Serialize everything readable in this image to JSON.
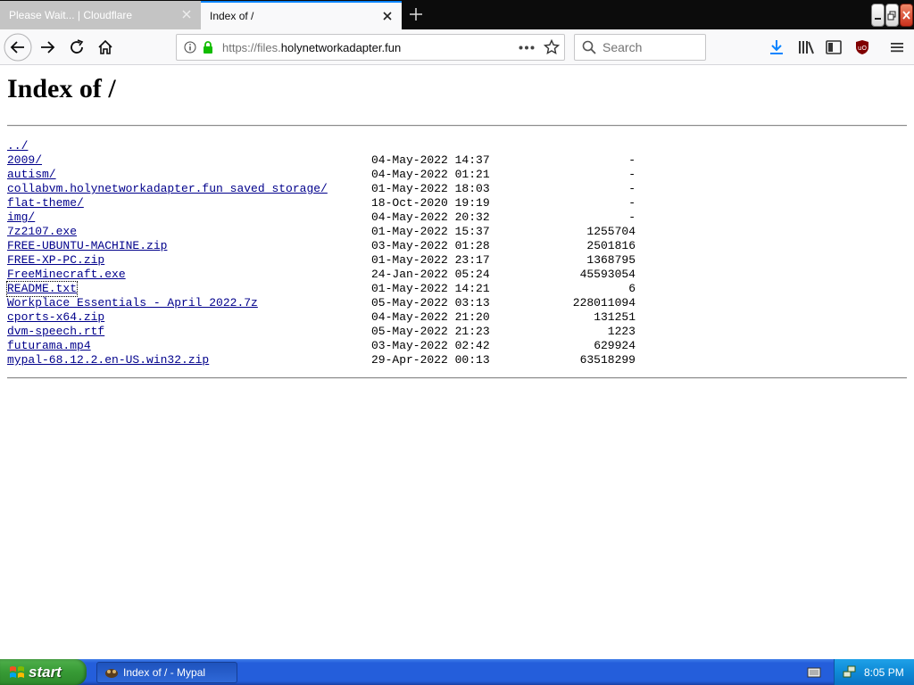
{
  "browser": {
    "tabs": [
      {
        "title": "Please Wait... | Cloudflare",
        "active": false
      },
      {
        "title": "Index of /",
        "active": true
      }
    ],
    "url": {
      "scheme": "https://files.",
      "host": "holynetworkadapter.fun"
    },
    "search_placeholder": "Search",
    "accent_color": "#0a84ff"
  },
  "page": {
    "heading": "Index of /",
    "parent_link": "../",
    "entries": [
      {
        "name": "2009/",
        "date": "04-May-2022 14:37",
        "size": "-"
      },
      {
        "name": "autism/",
        "date": "04-May-2022 01:21",
        "size": "-"
      },
      {
        "name": "collabvm.holynetworkadapter.fun saved storage/",
        "date": "01-May-2022 18:03",
        "size": "-"
      },
      {
        "name": "flat-theme/",
        "date": "18-Oct-2020 19:19",
        "size": "-"
      },
      {
        "name": "img/",
        "date": "04-May-2022 20:32",
        "size": "-"
      },
      {
        "name": "7z2107.exe",
        "date": "01-May-2022 15:37",
        "size": "1255704"
      },
      {
        "name": "FREE-UBUNTU-MACHINE.zip",
        "date": "03-May-2022 01:28",
        "size": "2501816"
      },
      {
        "name": "FREE-XP-PC.zip",
        "date": "01-May-2022 23:17",
        "size": "1368795"
      },
      {
        "name": "FreeMinecraft.exe",
        "date": "24-Jan-2022 05:24",
        "size": "45593054"
      },
      {
        "name": "README.txt",
        "date": "01-May-2022 14:21",
        "size": "6",
        "focused": true
      },
      {
        "name": "Workplace Essentials - April 2022.7z",
        "date": "05-May-2022 03:13",
        "size": "228011094"
      },
      {
        "name": "cports-x64.zip",
        "date": "04-May-2022 21:20",
        "size": "131251"
      },
      {
        "name": "dvm-speech.rtf",
        "date": "05-May-2022 21:23",
        "size": "1223"
      },
      {
        "name": "futurama.mp4",
        "date": "03-May-2022 02:42",
        "size": "629924"
      },
      {
        "name": "mypal-68.12.2.en-US.win32.zip",
        "date": "29-Apr-2022 00:13",
        "size": "63518299"
      }
    ],
    "link_color": "#00008b"
  },
  "taskbar": {
    "start_label": "start",
    "task_label": "Index of / - Mypal",
    "clock": "8:05 PM"
  }
}
